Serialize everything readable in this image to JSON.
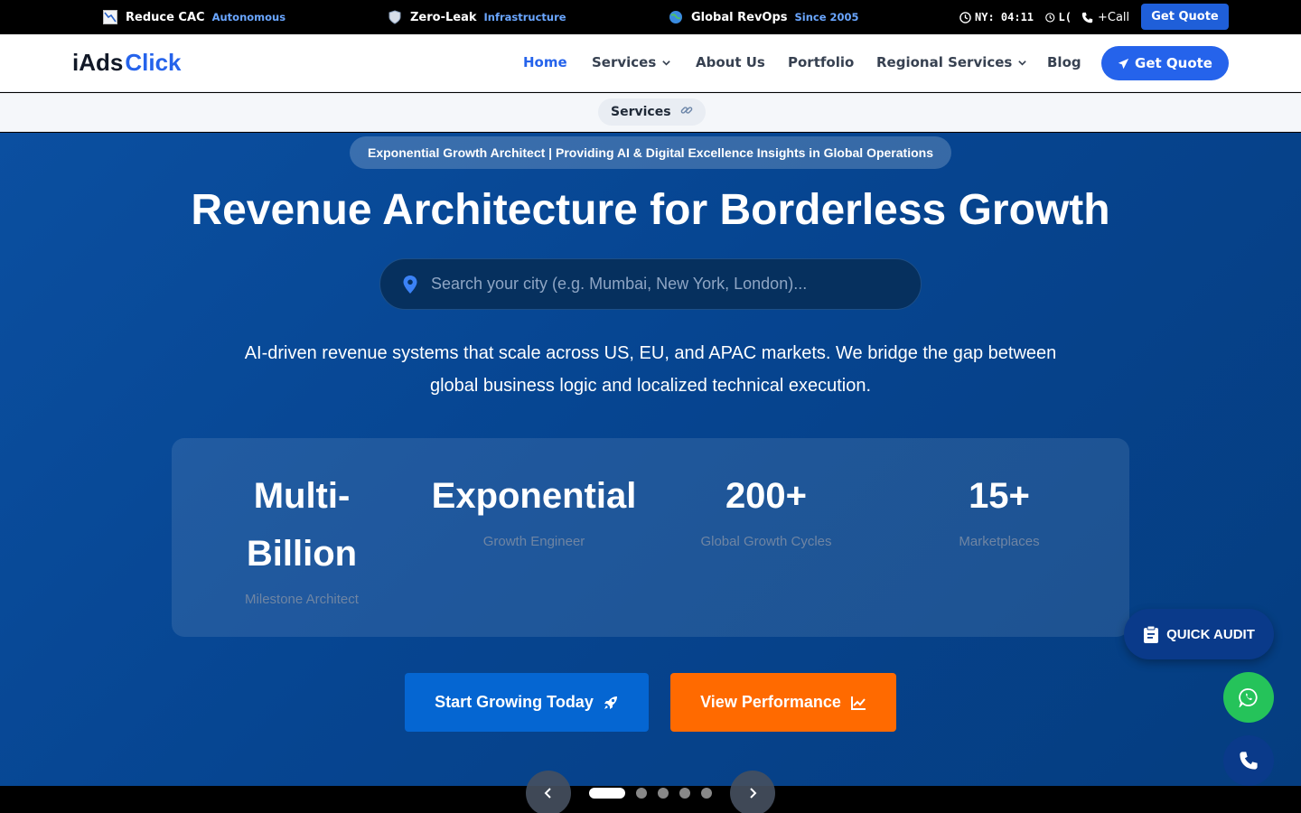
{
  "topbar": {
    "items": [
      {
        "icon": "chart-down-icon",
        "title": "Reduce CAC",
        "tag": "Autonomous"
      },
      {
        "icon": "shield-icon",
        "title": "Zero-Leak",
        "tag": "Infrastructure"
      },
      {
        "icon": "globe-icon",
        "title": "Global RevOps",
        "tag": "Since 2005"
      }
    ],
    "clock1": "NY: 04:11",
    "clock2": "L(",
    "call_label": "+Call",
    "quote_label": "Get Quote"
  },
  "nav": {
    "logo_a": "iAds",
    "logo_b": "Click",
    "links": [
      "Home",
      "Services",
      "About Us",
      "Portfolio",
      "Regional Services",
      "Blog"
    ],
    "quote_label": "Get Quote"
  },
  "subbar": {
    "label": "Services"
  },
  "hero": {
    "pill": "Exponential Growth Architect | Providing AI & Digital Excellence Insights in Global Operations",
    "title": "Revenue Architecture for Borderless Growth",
    "search_placeholder": "Search your city (e.g. Mumbai, New York, London)...",
    "description": "AI-driven revenue systems that scale across US, EU, and APAC markets. We bridge the gap between global business logic and localized technical execution.",
    "stats": [
      {
        "value_line1": "Multi-",
        "value_line2": "Billion",
        "label": "Milestone Architect"
      },
      {
        "value": "Exponential",
        "label": "Growth Engineer"
      },
      {
        "value": "200+",
        "label": "Global Growth Cycles"
      },
      {
        "value": "15+",
        "label": "Marketplaces"
      }
    ],
    "cta_primary": "Start Growing Today",
    "cta_secondary": "View Performance"
  },
  "slider": {
    "active_index": 0,
    "count": 5
  },
  "floating": {
    "quick_audit": "QUICK AUDIT"
  },
  "colors": {
    "brand_blue": "#2563eb",
    "hero_bg": "#064591",
    "orange": "#ff6a00",
    "whatsapp": "#25c35a"
  }
}
